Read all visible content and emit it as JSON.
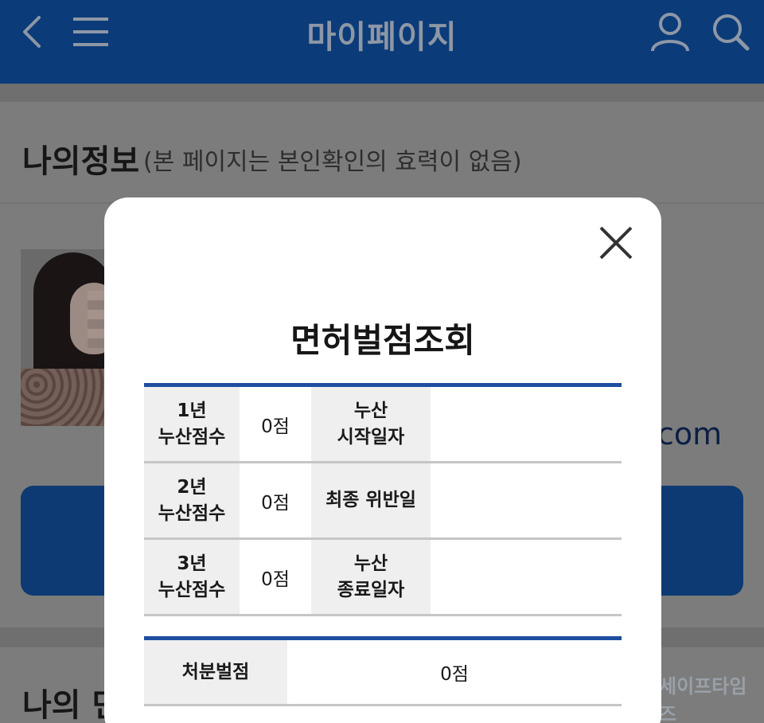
{
  "header": {
    "title": "마이페이지",
    "back_icon": "chevron-left-icon",
    "menu_icon": "hamburger-menu-icon",
    "user_icon": "user-icon",
    "search_icon": "search-icon",
    "background": "#0b3c79"
  },
  "my_info": {
    "title": "나의정보",
    "note": "(본 페이지는 본인확인의 효력이 없음)",
    "email_fragment": "com"
  },
  "section2": {
    "title_fragment": "나의 면"
  },
  "watermark": "세이프타임즈",
  "modal": {
    "title": "면허벌점조회",
    "close_icon": "close-icon",
    "rows": [
      {
        "label": [
          "1년",
          "누산점수"
        ],
        "value": "0점",
        "label2": [
          "누산",
          "시작일자"
        ],
        "value2": ""
      },
      {
        "label": [
          "2년",
          "누산점수"
        ],
        "value": "0점",
        "label2": [
          "최종 위반일"
        ],
        "value2": ""
      },
      {
        "label": [
          "3년",
          "누산점수"
        ],
        "value": "0점",
        "label2": [
          "누산",
          "종료일자"
        ],
        "value2": ""
      }
    ],
    "penalty": {
      "label": "처분벌점",
      "value": "0점"
    },
    "accent": "#1d4ea0"
  }
}
